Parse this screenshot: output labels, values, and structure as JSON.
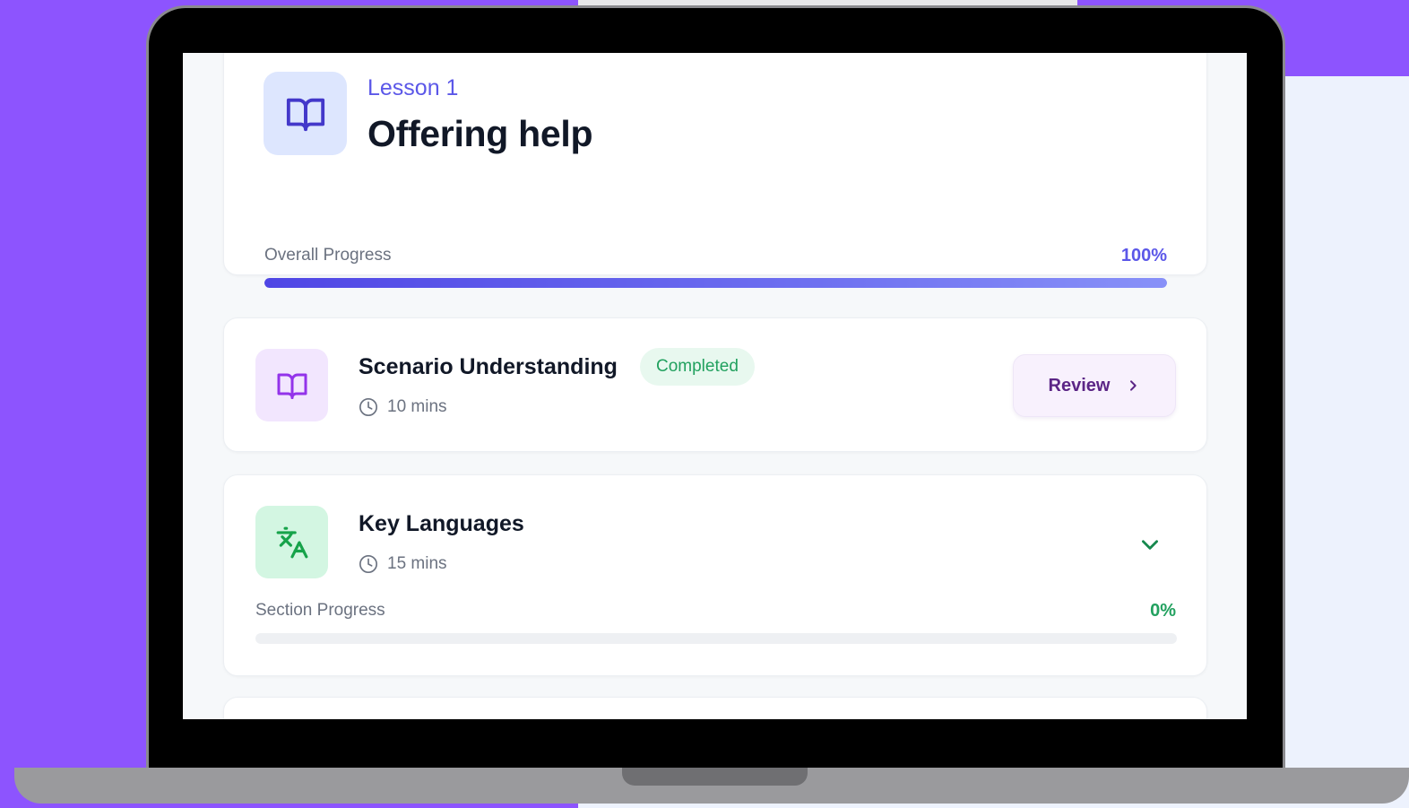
{
  "header": {
    "icon": "book-open-icon",
    "lesson_label": "Lesson 1",
    "title": "Offering help",
    "progress_label": "Overall Progress",
    "progress_text": "100%",
    "progress_fraction": 1.0
  },
  "sections": [
    {
      "icon": "book-open-icon",
      "title": "Scenario Understanding",
      "badge": "Completed",
      "duration": "10 mins",
      "action_label": "Review"
    },
    {
      "icon": "translate-icon",
      "title": "Key Languages",
      "duration": "15 mins",
      "progress_label": "Section Progress",
      "progress_text": "0%",
      "progress_fraction": 0.0
    }
  ],
  "colors": {
    "background_purple": "#8d54fe",
    "accent_indigo": "#5b57e8",
    "accent_green": "#22a15f",
    "review_text": "#5b2586"
  }
}
